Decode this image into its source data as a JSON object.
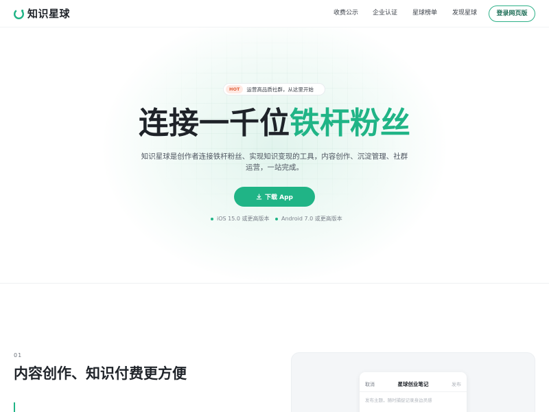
{
  "header": {
    "logo_text": "知识星球",
    "nav": [
      "收费公示",
      "企业认证",
      "星球榜单",
      "发现星球"
    ],
    "login_label": "登录网页版"
  },
  "hero": {
    "badge": "HOT",
    "badge_text": "运营高品质社群，从这里开始",
    "title_main": "连接一千位",
    "title_accent": "铁杆粉丝",
    "description_line1": "知识星球是创作者连接铁杆粉丝、实现知识变现的工具，内容创作、沉淀管理、社群",
    "description_line2": "运营，一站完成。",
    "download_label": "下载 App",
    "requirements": [
      "iOS 15.0 或更高版本",
      "Android 7.0 或更高版本"
    ]
  },
  "section": {
    "number": "01",
    "title": "内容创作、知识付费更方便"
  },
  "preview": {
    "cancel": "取消",
    "title": "星球创业笔记",
    "publish": "发布",
    "placeholder": "发布主题，随时捕捉记录身边灵感"
  },
  "colors": {
    "brand_green": "#20b486",
    "hot_red": "#e0603a",
    "text_dark": "#1f2329"
  },
  "icons": {
    "logo": "logo-ring-icon",
    "download": "download-icon"
  }
}
